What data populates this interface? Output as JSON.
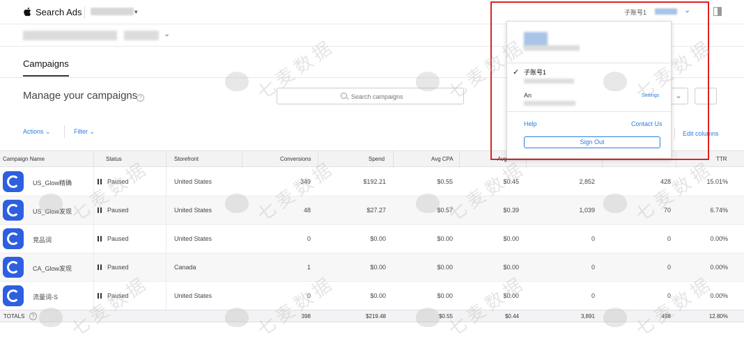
{
  "topbar": {
    "brand": "Search Ads",
    "account_name": "子账号1"
  },
  "tabs": {
    "campaigns": "Campaigns"
  },
  "page": {
    "title": "Manage your campaigns",
    "help": "?"
  },
  "search": {
    "placeholder": "Search campaigns"
  },
  "toolbar": {
    "actions": "Actions",
    "filter": "Filter",
    "edit_columns": "Edit columns"
  },
  "table": {
    "columns": [
      "Campaign Name",
      "Status",
      "Storefront",
      "Conversions",
      "Spend",
      "Avg CPA",
      "Avg",
      "TTR"
    ],
    "rows": [
      {
        "name": "US_Glow精确",
        "status": "Paused",
        "storefront": "United States",
        "conversions": "349",
        "spend": "$192.21",
        "avg_cpa": "$0.55",
        "avg_cpt": "$0.45",
        "impressions": "2,852",
        "taps": "428",
        "ttr": "15.01%"
      },
      {
        "name": "US_Glow发现",
        "status": "Paused",
        "storefront": "United States",
        "conversions": "48",
        "spend": "$27.27",
        "avg_cpa": "$0.57",
        "avg_cpt": "$0.39",
        "impressions": "1,039",
        "taps": "70",
        "ttr": "6.74%"
      },
      {
        "name": "竞品词",
        "status": "Paused",
        "storefront": "United States",
        "conversions": "0",
        "spend": "$0.00",
        "avg_cpa": "$0.00",
        "avg_cpt": "$0.00",
        "impressions": "0",
        "taps": "0",
        "ttr": "0.00%"
      },
      {
        "name": "CA_Glow发现",
        "status": "Paused",
        "storefront": "Canada",
        "conversions": "1",
        "spend": "$0.00",
        "avg_cpa": "$0.00",
        "avg_cpt": "$0.00",
        "impressions": "0",
        "taps": "0",
        "ttr": "0.00%"
      },
      {
        "name": "流量词-S",
        "status": "Paused",
        "storefront": "United States",
        "conversions": "0",
        "spend": "$0.00",
        "avg_cpa": "$0.00",
        "avg_cpt": "$0.00",
        "impressions": "0",
        "taps": "0",
        "ttr": "0.00%"
      }
    ],
    "totals": {
      "label": "TOTALS",
      "conversions": "398",
      "spend": "$219.48",
      "avg_cpa": "$0.55",
      "avg_cpt": "$0.44",
      "impressions": "3,891",
      "taps": "498",
      "ttr": "12.80%"
    }
  },
  "dropdown": {
    "check": "✓",
    "sub_account": "子账号1",
    "an": "An",
    "settings": "Settings",
    "help": "Help",
    "contact": "Contact Us",
    "sign_out": "Sign Out"
  },
  "watermark": {
    "text": "七麦数据"
  },
  "colors": {
    "link": "#2a7bde",
    "highlight": "#e02020",
    "app_icon": "#2d5fe0"
  }
}
